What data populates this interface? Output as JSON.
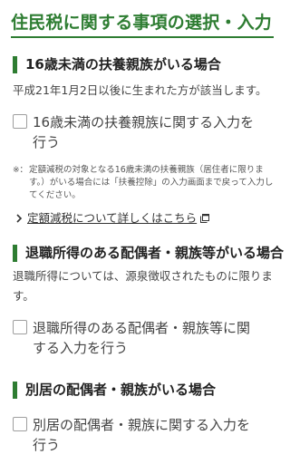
{
  "page": {
    "title": "住民税に関する事項の選択・入力"
  },
  "sections": [
    {
      "heading": "16歳未満の扶養親族がいる場合",
      "description": "平成21年1月2日以後に生まれた方が該当します。",
      "checkbox_label": "16歳未満の扶養親族に関する入力を行う",
      "checked": false,
      "note_mark": "※：",
      "note": "定額減税の対象となる16歳未満の扶養親族（居住者に限ります。）がいる場合には「扶養控除」の入力画面まで戻って入力してください。",
      "link_text": "定額減税について詳しくはこちら"
    },
    {
      "heading": "退職所得のある配偶者・親族等がいる場合",
      "description": "退職所得については、源泉徴収されたものに限ります。",
      "checkbox_label": "退職所得のある配偶者・親族等に関する入力を行う",
      "checked": false
    },
    {
      "heading": "別居の配偶者・親族がいる場合",
      "checkbox_label": "別居の配偶者・親族に関する入力を行う",
      "checked": false
    }
  ],
  "theme": {
    "accent": "#2e7d32",
    "text": "#333333"
  },
  "icons": {
    "link_chevron": "chevron-right-icon",
    "link_external": "external-window-icon"
  }
}
